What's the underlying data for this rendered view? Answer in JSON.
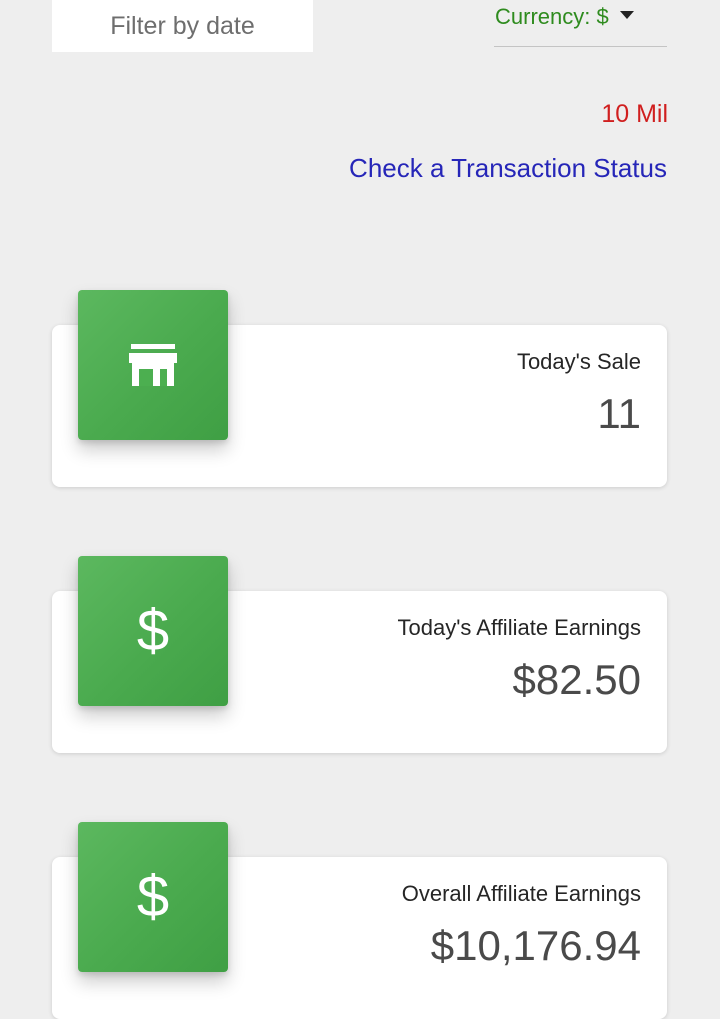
{
  "filter": {
    "placeholder": "Filter by date"
  },
  "currency": {
    "label": "Currency: $",
    "color": "#2e8b1e"
  },
  "notice": {
    "text": "10 Mil",
    "color": "#d01f1f"
  },
  "link": {
    "text": "Check a Transaction Status",
    "color": "#2626b8"
  },
  "accent_color": "#4caf50",
  "cards": [
    {
      "icon": "store-icon",
      "title": "Today's Sale",
      "value": "11"
    },
    {
      "icon": "dollar-icon",
      "title": "Today's Affiliate Earnings",
      "value": "$82.50"
    },
    {
      "icon": "dollar-icon",
      "title": "Overall Affiliate Earnings",
      "value": "$10,176.94"
    }
  ]
}
